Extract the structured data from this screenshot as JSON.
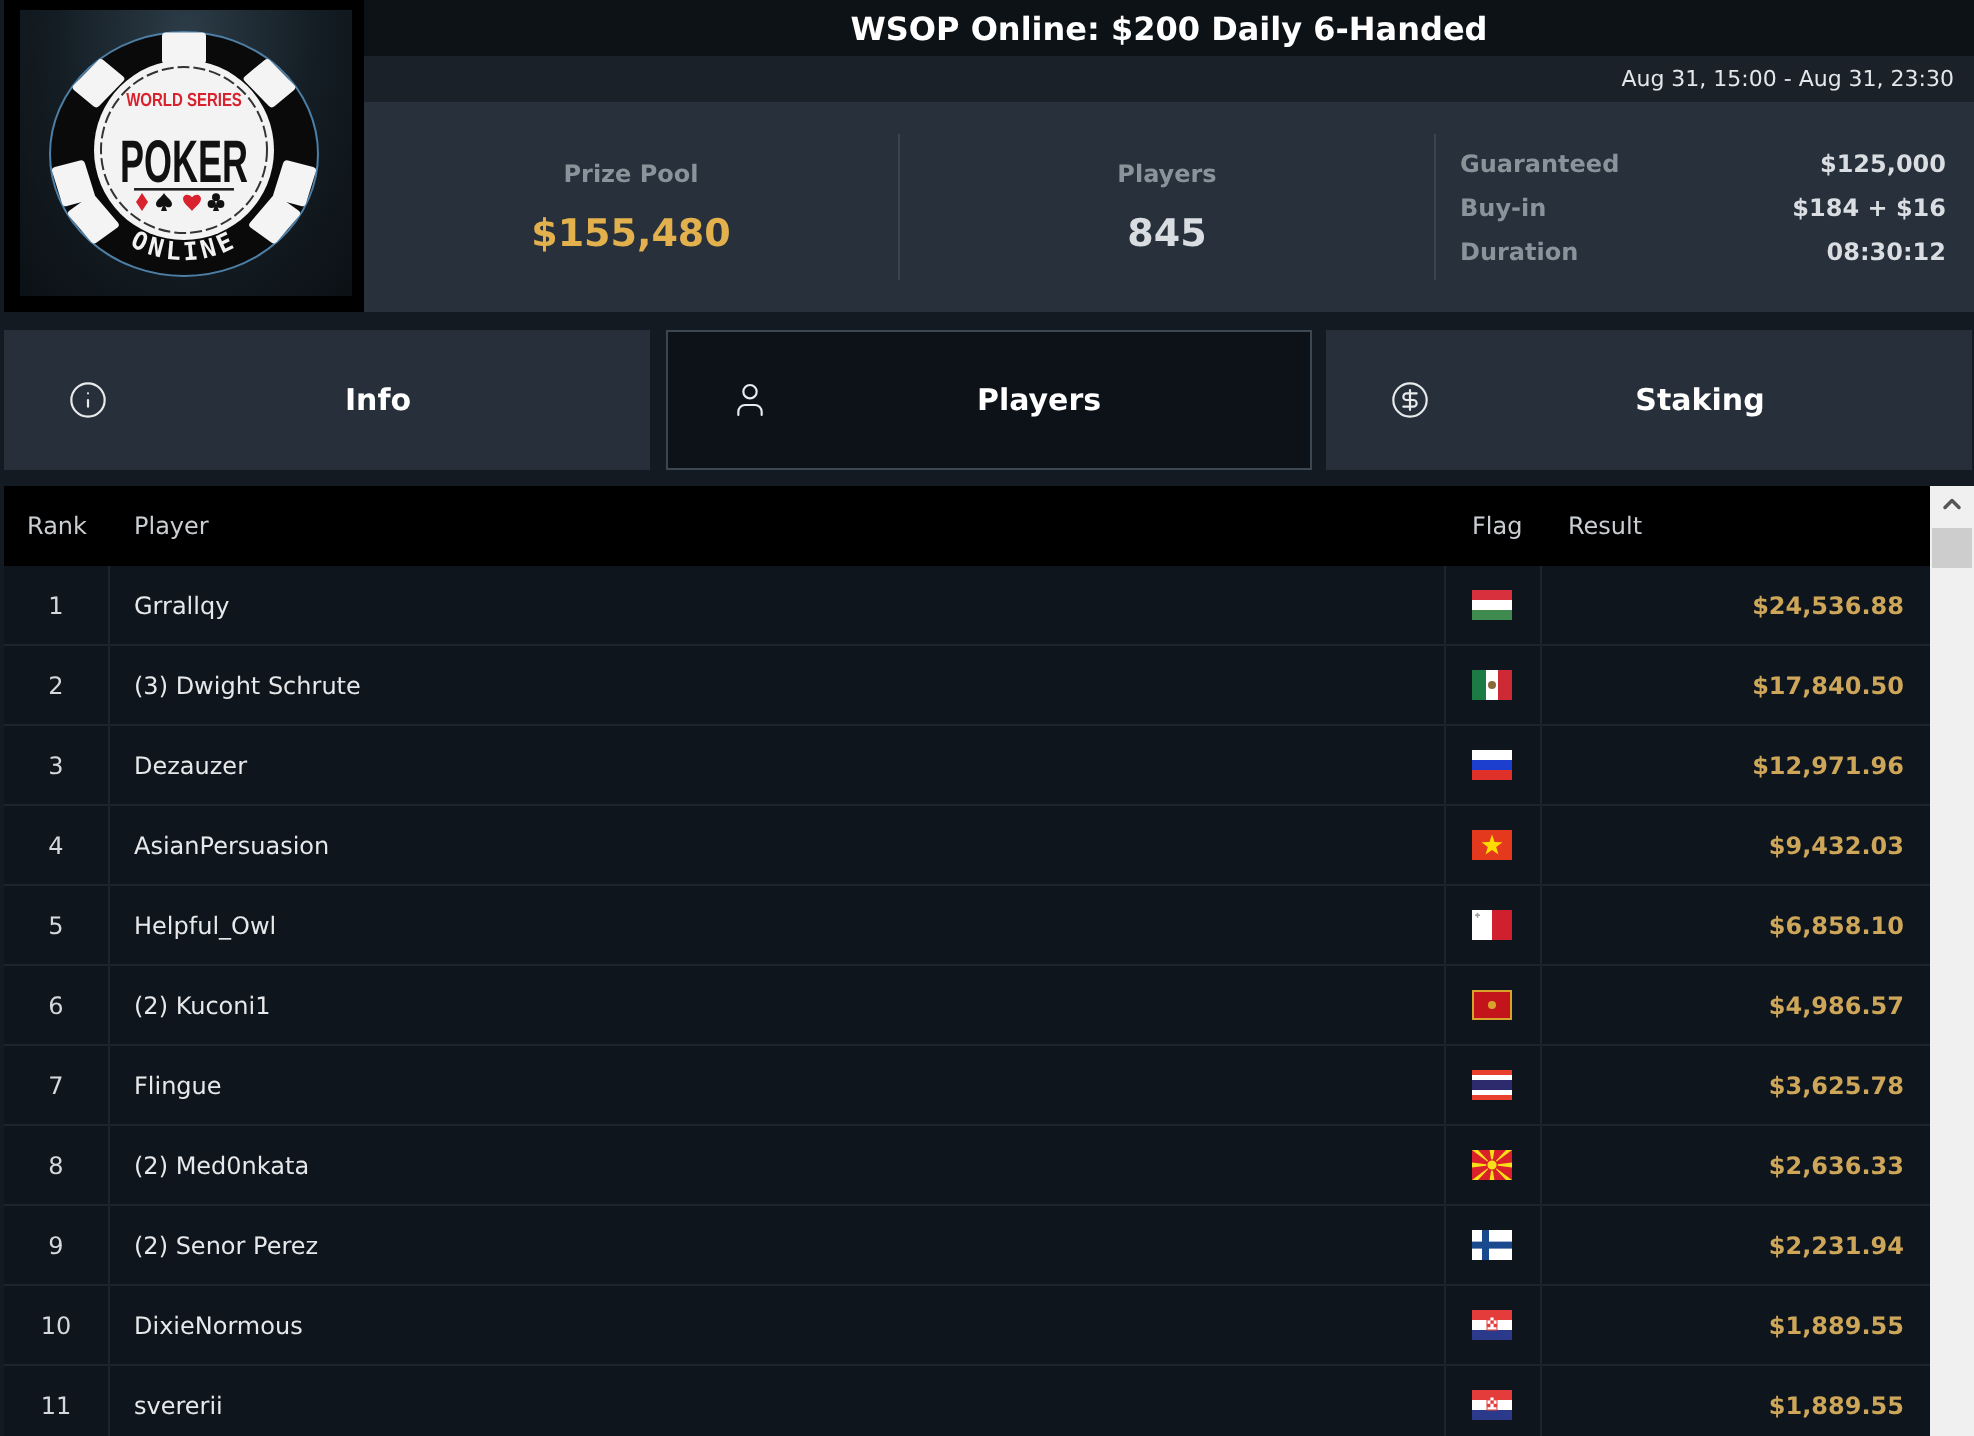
{
  "logo": {
    "top": "WORLD SERIES",
    "main": "POKER",
    "bottom": "ONLINE"
  },
  "header": {
    "title": "WSOP Online: $200 Daily 6-Handed",
    "dates": "Aug 31, 15:00 - Aug 31, 23:30"
  },
  "stats": [
    {
      "label": "Prize Pool",
      "value": "$155,480",
      "color": "#e2b14e"
    },
    {
      "label": "Players",
      "value": "845",
      "color": "#d9dde1"
    }
  ],
  "details": [
    {
      "label": "Guaranteed",
      "value": "$125,000"
    },
    {
      "label": "Buy-in",
      "value": "$184 + $16"
    },
    {
      "label": "Duration",
      "value": "08:30:12"
    }
  ],
  "tabs": [
    {
      "label": "Info",
      "selected": false
    },
    {
      "label": "Players",
      "selected": true
    },
    {
      "label": "Staking",
      "selected": false
    }
  ],
  "table": {
    "columns": [
      "Rank",
      "Player",
      "Flag",
      "Result"
    ],
    "rows": [
      {
        "rank": "1",
        "player": "Grrallqy",
        "flag": {
          "kind": "hungary"
        },
        "result": "$24,536.88"
      },
      {
        "rank": "2",
        "player": "(3) Dwight Schrute",
        "flag": {
          "kind": "mexico"
        },
        "result": "$17,840.50"
      },
      {
        "rank": "3",
        "player": "Dezauzer",
        "flag": {
          "kind": "russia"
        },
        "result": "$12,971.96"
      },
      {
        "rank": "4",
        "player": "AsianPersuasion",
        "flag": {
          "kind": "vietnam"
        },
        "result": "$9,432.03"
      },
      {
        "rank": "5",
        "player": "Helpful_Owl",
        "flag": {
          "kind": "malta"
        },
        "result": "$6,858.10"
      },
      {
        "rank": "6",
        "player": "(2) Kuconi1",
        "flag": {
          "kind": "montenegro"
        },
        "result": "$4,986.57"
      },
      {
        "rank": "7",
        "player": "Flingue",
        "flag": {
          "kind": "thailand"
        },
        "result": "$3,625.78"
      },
      {
        "rank": "8",
        "player": "(2) Med0nkata",
        "flag": {
          "kind": "macedonia"
        },
        "result": "$2,636.33"
      },
      {
        "rank": "9",
        "player": "(2) Senor Perez",
        "flag": {
          "kind": "finland"
        },
        "result": "$2,231.94"
      },
      {
        "rank": "10",
        "player": "DixieNormous",
        "flag": {
          "kind": "croatia"
        },
        "result": "$1,889.55"
      },
      {
        "rank": "11",
        "player": "svererii",
        "flag": {
          "kind": "croatia"
        },
        "result": "$1,889.55"
      }
    ]
  }
}
